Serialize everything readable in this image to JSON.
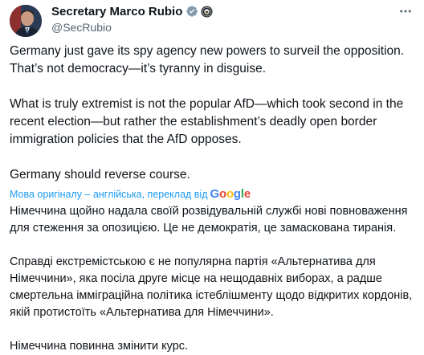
{
  "author": {
    "display_name": "Secretary Marco Rubio",
    "handle": "@SecRubio",
    "verified_color": "#829aab"
  },
  "post": {
    "paragraphs": [
      "Germany just gave its spy agency new powers to surveil the opposition.\nThat’s not democracy—it’s tyranny in disguise.",
      "What is truly extremist is not the popular AfD—which took second in the\nrecent election—but rather the establishment’s deadly open border\nimmigration policies that the AfD opposes.",
      "Germany should reverse course."
    ],
    "translation_label": "Мова оригіналу – англійська, переклад від",
    "translation_provider": "Google",
    "translated_paragraphs": [
      "Німеччина щойно надала своїй розвідувальній службі нові\nповноваження для стеження за опозицією. Це не демократія, це\nзамаскована тиранія.",
      "Справді екстремістською є не популярна партія «Альтернатива для\nНімеччини», яка посіла друге місце на нещодавніх виборах, а радше\nсмертельна імміграційна політика істеблішменту щодо відкритих\nкордонів, якій протистоїть «Альтернатива для Німеччини».",
      "Німеччина повинна змінити курс."
    ]
  },
  "colors": {
    "link": "#1d9bf0",
    "secondary_text": "#536471",
    "text": "#0f1419"
  },
  "icons": {
    "verified": "verified-badge-icon",
    "seal": "government-seal-icon",
    "more": "more-dots-icon"
  }
}
